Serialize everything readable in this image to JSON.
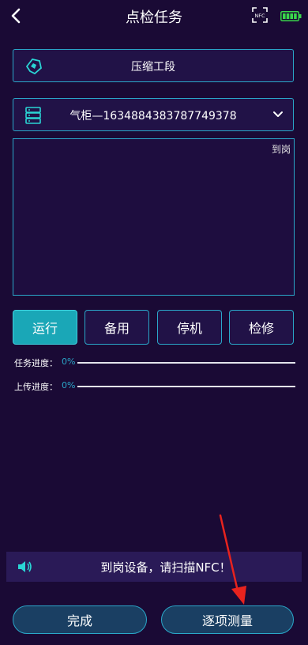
{
  "header": {
    "title": "点检任务",
    "nfc_icon_text": "NFC",
    "back_icon": "chevron-left-icon",
    "battery_icon": "battery-icon"
  },
  "section_selector": {
    "label": "压缩工段",
    "icon": "section-logo-icon"
  },
  "device_selector": {
    "label": "气柜—1634884383787749378",
    "icon": "server-rack-icon",
    "chevron": "chevron-down-icon"
  },
  "view_box": {
    "tag": "到岗"
  },
  "status_buttons": [
    {
      "label": "运行",
      "active": true
    },
    {
      "label": "备用",
      "active": false
    },
    {
      "label": "停机",
      "active": false
    },
    {
      "label": "检修",
      "active": false
    }
  ],
  "progress": {
    "task": {
      "label": "任务进度：",
      "value": "0%",
      "fraction": 0
    },
    "upload": {
      "label": "上传进度：",
      "value": "0%",
      "fraction": 0
    }
  },
  "notice": {
    "text": "到岗设备，请扫描NFC！",
    "icon": "speaker-icon"
  },
  "actions": {
    "finish": "完成",
    "measure": "逐项测量"
  },
  "colors": {
    "background": "#1a0a35",
    "accent": "#2aa7c9",
    "active_button": "#1aa7b7",
    "annotation_arrow": "#e8231e"
  }
}
